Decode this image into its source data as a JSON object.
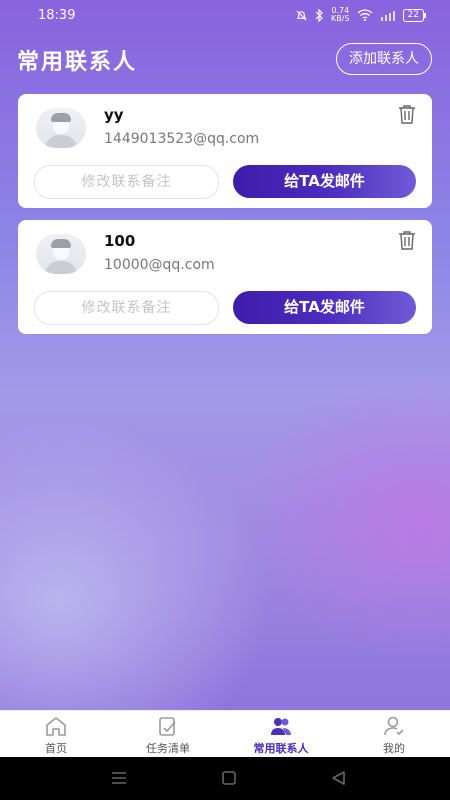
{
  "status_bar": {
    "time": "18:39",
    "net_speed_value": "0.74",
    "net_speed_unit": "KB/S",
    "battery": "22"
  },
  "header": {
    "title": "常用联系人",
    "add_button": "添加联系人"
  },
  "contacts": [
    {
      "name": "yy",
      "email": "1449013523@qq.com",
      "edit_label": "修改联系备注",
      "mail_label": "给TA发邮件"
    },
    {
      "name": "100",
      "email": "10000@qq.com",
      "edit_label": "修改联系备注",
      "mail_label": "给TA发邮件"
    }
  ],
  "tabbar": {
    "items": [
      {
        "label": "首页",
        "icon": "home-icon",
        "active": false
      },
      {
        "label": "任务清单",
        "icon": "task-list-icon",
        "active": false
      },
      {
        "label": "常用联系人",
        "icon": "contacts-icon",
        "active": true
      },
      {
        "label": "我的",
        "icon": "profile-icon",
        "active": false
      }
    ]
  },
  "colors": {
    "accent": "#4a2fb8",
    "button_start": "#3f1ca8",
    "button_end": "#6f5bd6"
  }
}
